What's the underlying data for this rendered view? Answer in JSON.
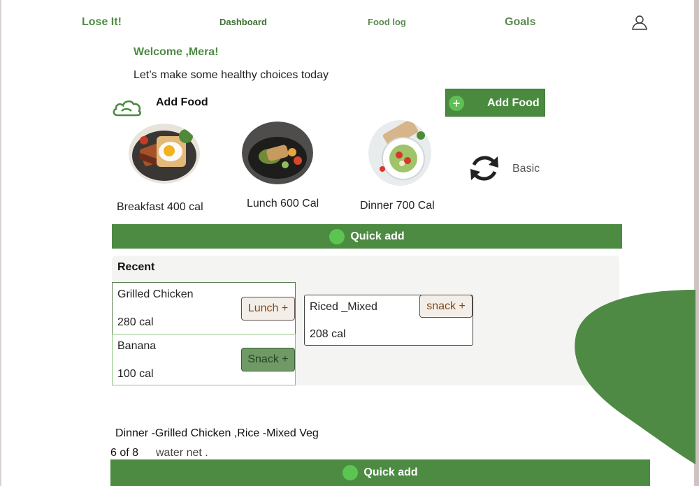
{
  "nav": {
    "brand": "Lose It!",
    "dashboard": "Dashboard",
    "food_log": "Food log",
    "goals": "Goals",
    "user_icon": "user-icon"
  },
  "header": {
    "welcome": "Welcome ,Mera!",
    "subtitle": "Let’s make some healthy choices today"
  },
  "add_food": {
    "label": "Add Food",
    "button_label": "Add Food",
    "icon": "cloud-icon"
  },
  "meals": [
    {
      "label": "Breakfast 400 cal",
      "image": "breakfast-photo"
    },
    {
      "label": "Lunch 600 Cal",
      "image": "lunch-photo"
    },
    {
      "label": "Dinner 700 Cal",
      "image": "dinner-photo"
    }
  ],
  "plan": {
    "label": "Basic",
    "icon": "refresh-icon"
  },
  "quick_add": {
    "label": "Quick add"
  },
  "recent": {
    "title": "Recent",
    "items": [
      {
        "name": "Grilled Chicken",
        "cal": "280 cal",
        "button": "Lunch +"
      },
      {
        "name": "Banana",
        "cal": "100 cal",
        "button": "Snack +"
      },
      {
        "name": "Riced _Mixed",
        "cal": "208 cal",
        "button": "snack +"
      }
    ]
  },
  "footer": {
    "summary": "Dinner -Grilled Chicken ,Rice -Mixed Veg",
    "count": "6 of 8",
    "water": "water net .",
    "quick_add": "Quick add"
  },
  "colors": {
    "primary": "#4c8b41",
    "accent": "#5cc552",
    "brand_text": "#4e8a45"
  }
}
